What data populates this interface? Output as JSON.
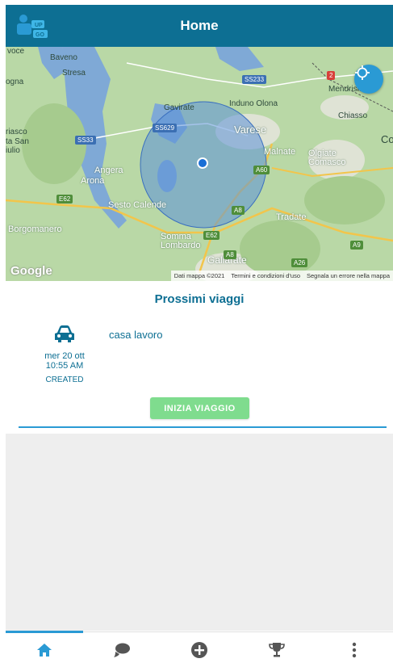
{
  "app": {
    "title": "Home",
    "colors": {
      "primary": "#0d6f93",
      "accent": "#2a9ad4",
      "start_button": "#7fdc8e"
    }
  },
  "map": {
    "labels": {
      "baveno": "Baveno",
      "stresa": "Stresa",
      "gavirate": "Gavirate",
      "induno": "Induno Olona",
      "varese": "Varese",
      "malnate": "Malnate",
      "olgiate": "Olgiate Comasco",
      "angera": "Angera",
      "arona": "Arona",
      "sesto": "Sesto Calende",
      "tradate": "Tradate",
      "borgomanero": "Borgomanero",
      "somma": "Somma Lombardo",
      "gallarate": "Gallarate",
      "mendrisio": "Mendrisio",
      "chiasso": "Chiasso",
      "san_giulio": "ta San iulio",
      "riasco": "riasco",
      "ogna": "ogna",
      "voce": "voce",
      "co": "Co"
    },
    "roads": {
      "ss233_top": "SS233",
      "ss33": "SS33",
      "ss629": "SS629",
      "a8_a": "A8",
      "a8_b": "A8",
      "a9": "A9",
      "a26": "A26",
      "a60": "A60",
      "e62_a": "E62",
      "e62_b": "E62",
      "r2": "2"
    },
    "google_logo": "Google",
    "attribution": {
      "data": "Dati mappa ©2021",
      "terms": "Termini e condizioni d'uso",
      "report": "Segnala un errore nella mappa"
    },
    "locate_icon": "crosshair-icon"
  },
  "upcoming": {
    "section_title": "Prossimi viaggi",
    "trips": [
      {
        "icon": "car-icon",
        "name": "casa lavoro",
        "date_line1": "mer 20 ott",
        "date_line2": "10:55 AM",
        "status": "CREATED"
      }
    ],
    "start_button": "INIZIA VIAGGIO"
  },
  "bottom_nav": {
    "items": [
      {
        "icon": "home-icon",
        "active": true
      },
      {
        "icon": "chat-icon",
        "active": false
      },
      {
        "icon": "add-circle-icon",
        "active": false
      },
      {
        "icon": "trophy-icon",
        "active": false
      },
      {
        "icon": "more-vert-icon",
        "active": false
      }
    ]
  }
}
